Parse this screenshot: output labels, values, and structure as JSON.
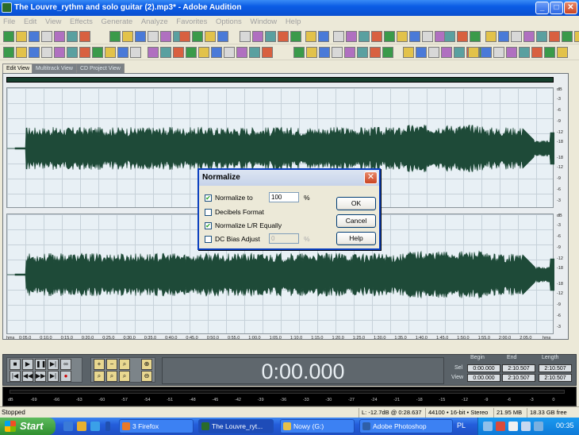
{
  "window": {
    "title": "The Louvre_rythm and solo guitar (2).mp3* - Adobe Audition",
    "minimize": "_",
    "maximize": "□",
    "close": "✕"
  },
  "menu": [
    "File",
    "Edit",
    "View",
    "Effects",
    "Generate",
    "Analyze",
    "Favorites",
    "Options",
    "Window",
    "Help"
  ],
  "tabs": [
    "Edit View",
    "Multitrack View",
    "CD Project View"
  ],
  "ruler": {
    "start": "hms",
    "end": "hms",
    "ticks": [
      "0:05.0",
      "0:10.0",
      "0:15.0",
      "0:20.0",
      "0:25.0",
      "0:30.0",
      "0:35.0",
      "0:40.0",
      "0:45.0",
      "0:50.0",
      "0:55.0",
      "1:00.0",
      "1:05.0",
      "1:10.0",
      "1:15.0",
      "1:20.0",
      "1:25.0",
      "1:30.0",
      "1:35.0",
      "1:40.0",
      "1:45.0",
      "1:50.0",
      "1:55.0",
      "2:00.0",
      "2:05.0"
    ]
  },
  "db_scale": {
    "unit": "dB",
    "top": [
      "-3",
      "-6",
      "-9",
      "-12",
      "-18",
      "-18",
      "-12",
      "-9",
      "-6",
      "-3"
    ],
    "bottom": [
      "-3",
      "-6",
      "-9",
      "-12",
      "-18",
      "-18",
      "-12",
      "-9",
      "-6",
      "-3"
    ]
  },
  "transport": {
    "time": "0:00.000",
    "labels": {
      "begin": "Begin",
      "end": "End",
      "length": "Length",
      "sel": "Sel",
      "view": "View"
    },
    "sel": {
      "begin": "0:00.000",
      "end": "2:10.507",
      "length": "2:10.507"
    },
    "view": {
      "begin": "0:00.000",
      "end": "2:10.507",
      "length": "2:10.507"
    }
  },
  "meter": {
    "ticks": [
      "dB",
      "-69",
      "-66",
      "-63",
      "-60",
      "-57",
      "-54",
      "-51",
      "-48",
      "-45",
      "-42",
      "-39",
      "-36",
      "-33",
      "-30",
      "-27",
      "-24",
      "-21",
      "-18",
      "-15",
      "-12",
      "-9",
      "-6",
      "-3",
      "0"
    ]
  },
  "status": {
    "state": "Stopped",
    "level": "L: -12.7dB @ 0:28.637",
    "format": "44100 • 16-bit • Stereo",
    "size": "21.95 MB",
    "free": "18.33 GB free"
  },
  "dialog": {
    "title": "Normalize",
    "close": "✕",
    "normalize_to_label": "Normalize to",
    "normalize_to_value": "100",
    "percent": "%",
    "decibels_label": "Decibels Format",
    "lr_label": "Normalize L/R Equally",
    "dc_label": "DC Bias Adjust",
    "dc_value": "0",
    "ok": "OK",
    "cancel": "Cancel",
    "help": "Help",
    "checked": {
      "normalize_to": true,
      "decibels": false,
      "lr": true,
      "dc": false
    }
  },
  "taskbar": {
    "start": "Start",
    "tasks": [
      "3 Firefox",
      "The Louvre_ryt...",
      "Nowy (G:)",
      "Adobe Photoshop"
    ],
    "lang": "PL",
    "clock": "00:35"
  },
  "colors": {
    "waveform": "#1e4a38",
    "title_blue": "#0b5ce5",
    "transport_bg": "#5a6268"
  }
}
